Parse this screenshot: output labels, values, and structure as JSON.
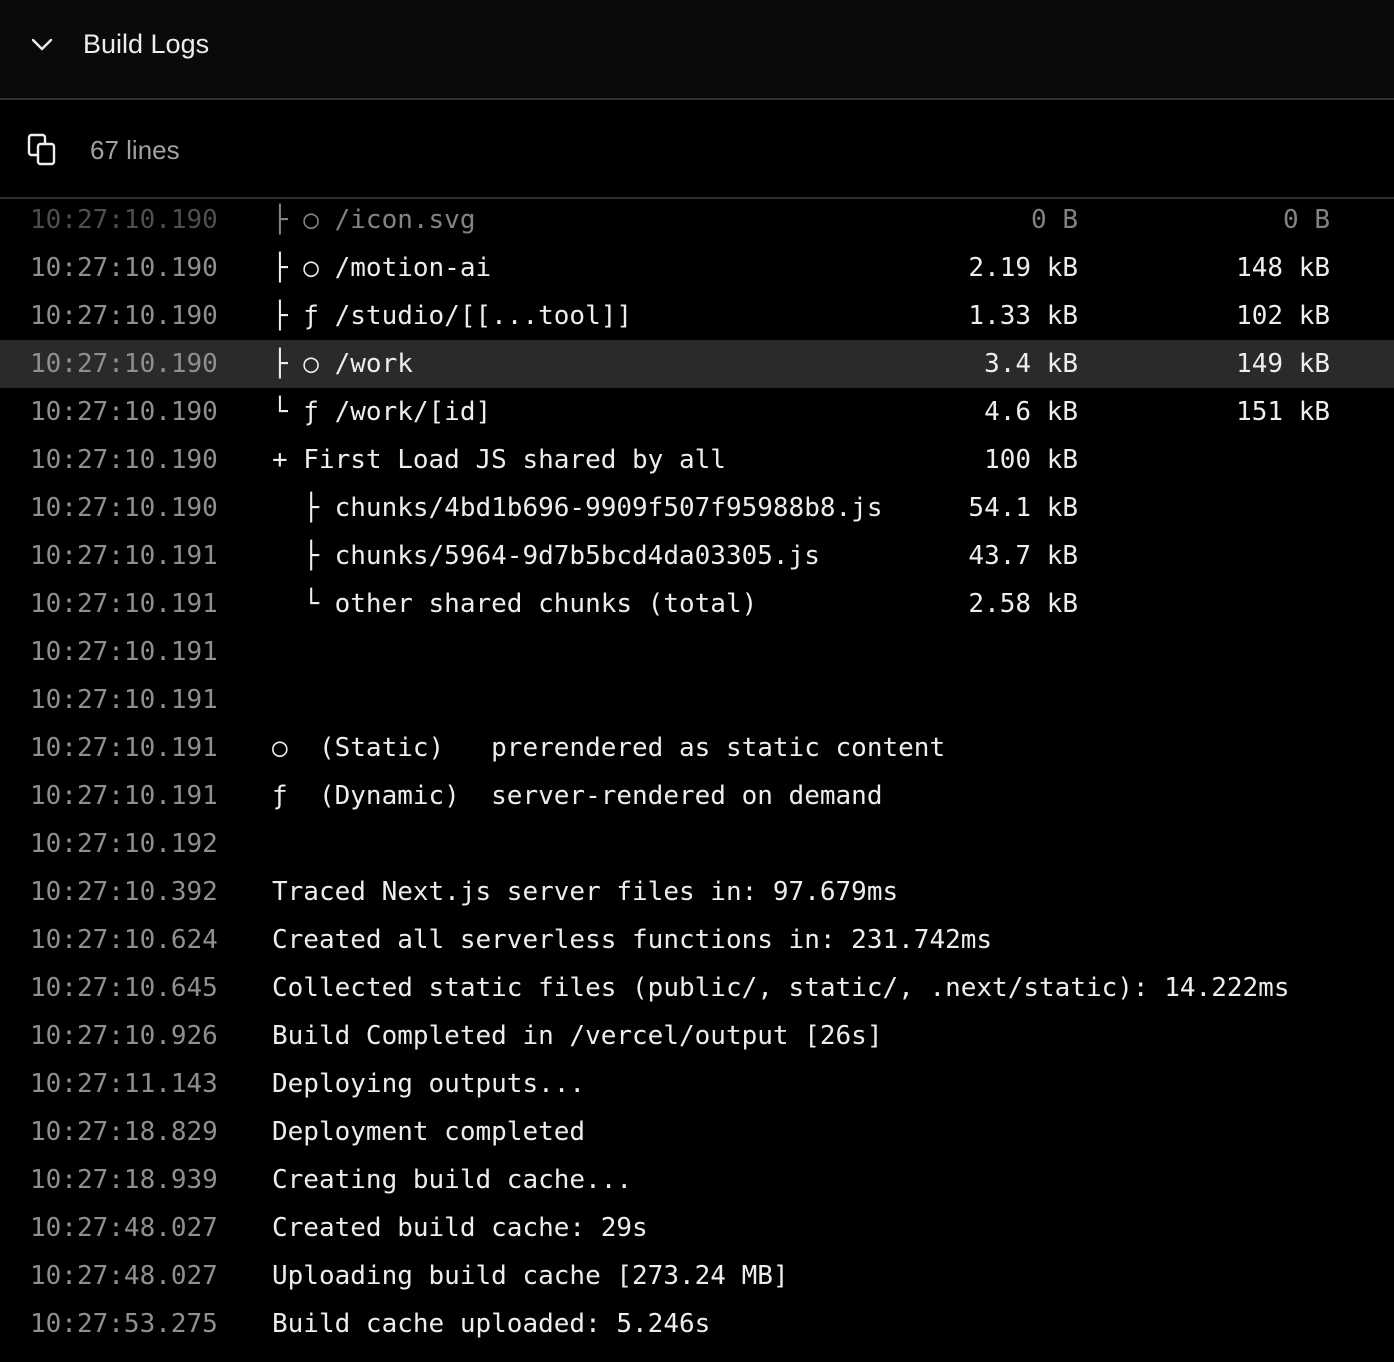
{
  "header": {
    "title": "Build Logs",
    "toggle_icon": "chevron-down-icon"
  },
  "toolbar": {
    "copy_icon": "copy-icon",
    "line_count": "67 lines"
  },
  "rows": [
    {
      "time": "10:27:10.190",
      "text": "├ ○ /icon.svg",
      "size": "0 B",
      "first_load": "0 B"
    },
    {
      "time": "10:27:10.190",
      "text": "├ ○ /motion-ai",
      "size": "2.19 kB",
      "first_load": "148 kB"
    },
    {
      "time": "10:27:10.190",
      "text": "├ ƒ /studio/[[...tool]]",
      "size": "1.33 kB",
      "first_load": "102 kB"
    },
    {
      "time": "10:27:10.190",
      "text": "├ ○ /work",
      "size": "3.4 kB",
      "first_load": "149 kB"
    },
    {
      "time": "10:27:10.190",
      "text": "└ ƒ /work/[id]",
      "size": "4.6 kB",
      "first_load": "151 kB"
    },
    {
      "time": "10:27:10.190",
      "text": "+ First Load JS shared by all",
      "size": "100 kB",
      "first_load": ""
    },
    {
      "time": "10:27:10.190",
      "text": "  ├ chunks/4bd1b696-9909f507f95988b8.js",
      "size": "54.1 kB",
      "first_load": ""
    },
    {
      "time": "10:27:10.191",
      "text": "  ├ chunks/5964-9d7b5bcd4da03305.js",
      "size": "43.7 kB",
      "first_load": ""
    },
    {
      "time": "10:27:10.191",
      "text": "  └ other shared chunks (total)",
      "size": "2.58 kB",
      "first_load": ""
    },
    {
      "time": "10:27:10.191",
      "text": "",
      "size": "",
      "first_load": ""
    },
    {
      "time": "10:27:10.191",
      "text": "",
      "size": "",
      "first_load": ""
    },
    {
      "time": "10:27:10.191",
      "text": "○  (Static)   prerendered as static content",
      "size": "",
      "first_load": ""
    },
    {
      "time": "10:27:10.191",
      "text": "ƒ  (Dynamic)  server-rendered on demand",
      "size": "",
      "first_load": ""
    },
    {
      "time": "10:27:10.192",
      "text": "",
      "size": "",
      "first_load": ""
    },
    {
      "time": "10:27:10.392",
      "text": "Traced Next.js server files in: 97.679ms",
      "size": "",
      "first_load": ""
    },
    {
      "time": "10:27:10.624",
      "text": "Created all serverless functions in: 231.742ms",
      "size": "",
      "first_load": ""
    },
    {
      "time": "10:27:10.645",
      "text": "Collected static files (public/, static/, .next/static): 14.222ms",
      "size": "",
      "first_load": ""
    },
    {
      "time": "10:27:10.926",
      "text": "Build Completed in /vercel/output [26s]",
      "size": "",
      "first_load": ""
    },
    {
      "time": "10:27:11.143",
      "text": "Deploying outputs...",
      "size": "",
      "first_load": ""
    },
    {
      "time": "10:27:18.829",
      "text": "Deployment completed",
      "size": "",
      "first_load": ""
    },
    {
      "time": "10:27:18.939",
      "text": "Creating build cache...",
      "size": "",
      "first_load": ""
    },
    {
      "time": "10:27:48.027",
      "text": "Created build cache: 29s",
      "size": "",
      "first_load": ""
    },
    {
      "time": "10:27:48.027",
      "text": "Uploading build cache [273.24 MB]",
      "size": "",
      "first_load": ""
    },
    {
      "time": "10:27:53.275",
      "text": "Build cache uploaded: 5.246s",
      "size": "",
      "first_load": ""
    }
  ]
}
